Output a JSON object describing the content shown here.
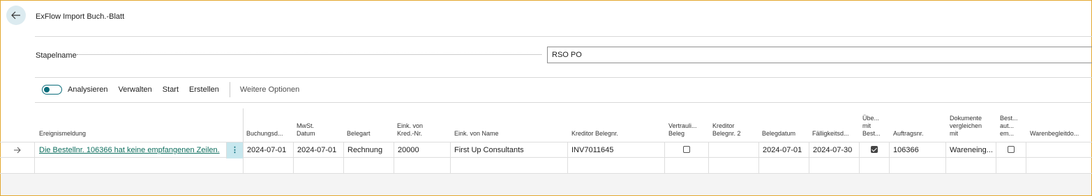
{
  "header": {
    "title": "ExFlow Import Buch.-Blatt"
  },
  "batch": {
    "label": "Stapelname",
    "value": "RSO PO"
  },
  "actions": {
    "analyze": "Analysieren",
    "manage": "Verwalten",
    "start": "Start",
    "create": "Erstellen",
    "more": "Weitere Optionen"
  },
  "columns": {
    "event": "Ereignismeldung",
    "posting_date": "Buchungsd...",
    "vat_date_1": "MwSt.",
    "vat_date_2": "Datum",
    "doc_type": "Belegart",
    "vendor_no_1": "Eink. von",
    "vendor_no_2": "Kred.-Nr.",
    "vendor_name": "Eink. von Name",
    "vendor_doc": "Kreditor Belegnr.",
    "confidential_1": "Vertrauli...",
    "confidential_2": "Beleg",
    "vendor_doc2_1": "Kreditor",
    "vendor_doc2_2": "Belegnr. 2",
    "doc_date": "Belegdatum",
    "due_date": "Fälligkeitsd...",
    "u1": "Übe...",
    "u2": "mit",
    "u3": "Best...",
    "order_no": "Auftragsnr.",
    "compare_1": "Dokumente",
    "compare_2": "vergleichen",
    "compare_3": "mit",
    "b1": "Best...",
    "b2": "aut...",
    "b3": "em...",
    "receipt": "Warenbegleitdo..."
  },
  "rows": [
    {
      "event": "Die Bestellnr. 106366 hat keine empfangenen Zeilen.",
      "posting_date": "2024-07-01",
      "vat_date": "2024-07-01",
      "doc_type": "Rechnung",
      "vendor_no": "20000",
      "vendor_name": "First Up Consultants",
      "vendor_doc": "INV7011645",
      "confidential": false,
      "vendor_doc2": "",
      "doc_date": "2024-07-01",
      "due_date": "2024-07-30",
      "with_order": true,
      "order_no": "106366",
      "compare_with": "Wareneing...",
      "order_auto": false,
      "receipt": ""
    }
  ],
  "colors": {
    "accent": "#0a6c7a",
    "link": "#0d6e5e",
    "frame": "#e3a72f"
  }
}
